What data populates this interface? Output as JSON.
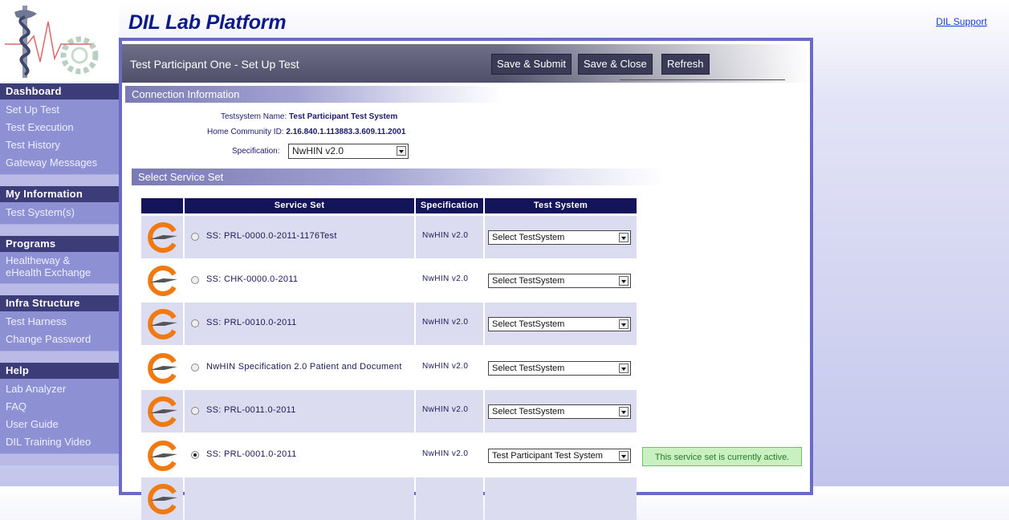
{
  "header": {
    "brand_title": "DIL Lab Platform",
    "support_link": "DIL Support"
  },
  "sidebar": {
    "sections": [
      {
        "title": "Dashboard",
        "items": [
          "Set Up Test",
          "Test Execution",
          "Test History",
          "Gateway Messages"
        ]
      },
      {
        "title": "My Information",
        "items": [
          "Test System(s)"
        ]
      },
      {
        "title": "Programs",
        "items": [
          "Healtheway & eHealth Exchange"
        ]
      },
      {
        "title": "Infra Structure",
        "items": [
          "Test Harness",
          "Change Password"
        ]
      },
      {
        "title": "Help",
        "items": [
          "Lab Analyzer",
          "FAQ",
          "User Guide",
          "DIL Training Video"
        ]
      }
    ]
  },
  "panel": {
    "title": "Test Participant One - Set Up Test",
    "buttons": {
      "save_submit": "Save & Submit",
      "save_close": "Save & Close",
      "refresh": "Refresh"
    }
  },
  "connection": {
    "section_title": "Connection Information",
    "testsystem_label": "Testsystem Name:",
    "testsystem_value": "Test Participant Test System",
    "hcid_label": "Home Community ID:",
    "hcid_value": "2.16.840.1.113883.3.609.11.2001",
    "spec_label": "Specification:",
    "spec_value": "NwHIN v2.0"
  },
  "service_sets": {
    "section_title": "Select Service Set",
    "columns": [
      "Service Set",
      "Specification",
      "Test System"
    ],
    "rows": [
      {
        "name": "SS: PRL-0000.0-2011-1176Test",
        "spec": "NwHIN v2.0",
        "system": "Select TestSystem",
        "selected": false
      },
      {
        "name": "SS: CHK-0000.0-2011",
        "spec": "NwHIN v2.0",
        "system": "Select TestSystem",
        "selected": false
      },
      {
        "name": "SS: PRL-0010.0-2011",
        "spec": "NwHIN v2.0",
        "system": "Select TestSystem",
        "selected": false
      },
      {
        "name": "NwHIN Specification 2.0 Patient and Document",
        "spec": "NwHIN v2.0",
        "system": "Select TestSystem",
        "selected": false
      },
      {
        "name": "SS: PRL-0011.0-2011",
        "spec": "NwHIN v2.0",
        "system": "Select TestSystem",
        "selected": false
      },
      {
        "name": "SS: PRL-0001.0-2011",
        "spec": "NwHIN v2.0",
        "system": "Test Participant Test System",
        "selected": true
      }
    ],
    "active_message": "This service set is currently active."
  },
  "colors": {
    "nav_header": "#3c3c78",
    "nav_items": "#8d90d2",
    "table_header": "#14145a",
    "row_bg": "#dcdcf0"
  }
}
